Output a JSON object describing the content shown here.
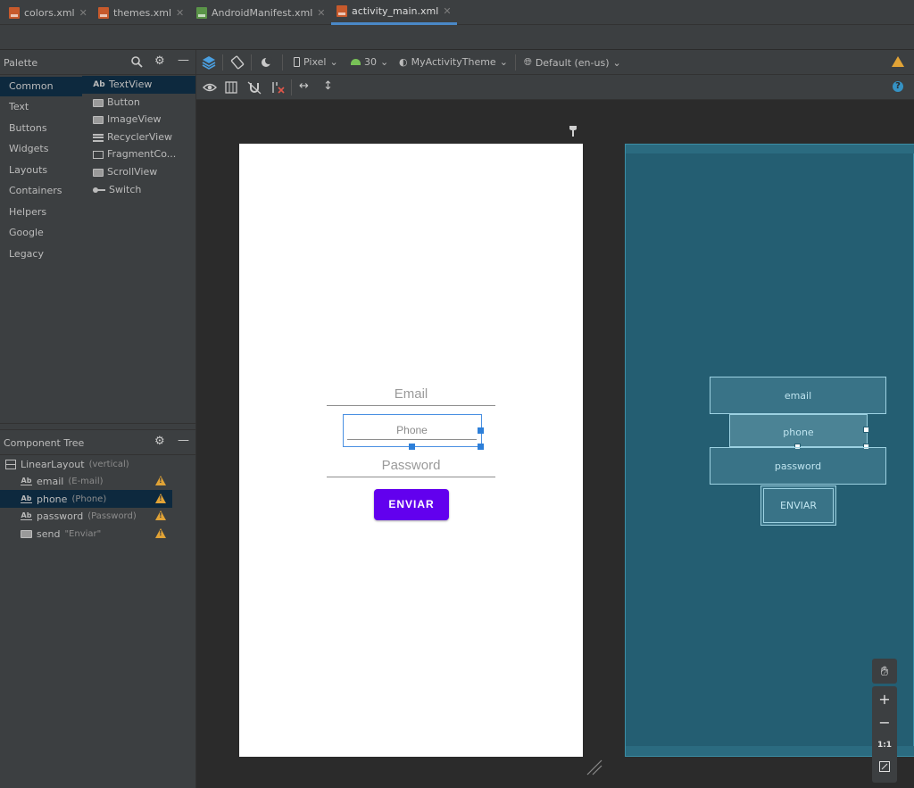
{
  "tabs": [
    {
      "label": "colors.xml",
      "icon": "xml-file-icon"
    },
    {
      "label": "themes.xml",
      "icon": "xml-file-icon"
    },
    {
      "label": "AndroidManifest.xml",
      "icon": "manifest-file-icon"
    },
    {
      "label": "activity_main.xml",
      "icon": "xml-file-icon",
      "active": true
    }
  ],
  "palette": {
    "title": "Palette",
    "categories": [
      "Common",
      "Text",
      "Buttons",
      "Widgets",
      "Layouts",
      "Containers",
      "Helpers",
      "Google",
      "Legacy"
    ],
    "selected_category": "Common",
    "items": [
      {
        "label": "TextView",
        "icon_glyph": "Ab"
      },
      {
        "label": "Button"
      },
      {
        "label": "ImageView"
      },
      {
        "label": "RecyclerView"
      },
      {
        "label": "FragmentCo..."
      },
      {
        "label": "ScrollView"
      },
      {
        "label": "Switch"
      }
    ]
  },
  "component_tree": {
    "title": "Component Tree",
    "root": {
      "label": "LinearLayout",
      "hint": "(vertical)"
    },
    "children": [
      {
        "icon_glyph": "Ab",
        "label": "email",
        "hint": "(E-mail)"
      },
      {
        "icon_glyph": "Ab",
        "label": "phone",
        "hint": "(Phone)",
        "selected": true
      },
      {
        "icon_glyph": "Ab",
        "label": "password",
        "hint": "(Password)"
      },
      {
        "label": "send",
        "hint": "\"Enviar\""
      }
    ]
  },
  "toolbar": {
    "device": "Pixel",
    "api": "30",
    "theme": "MyActivityTheme",
    "locale": "Default (en-us)"
  },
  "design": {
    "email_hint": "Email",
    "phone_hint": "Phone",
    "password_hint": "Password",
    "send_label": "ENVIAR"
  },
  "blueprint": {
    "email": "email",
    "phone": "phone",
    "password": "password",
    "send": "ENVIAR"
  },
  "zoom": {
    "reset_label": "1:1"
  },
  "colors": {
    "accent_button": "#6200ee",
    "blueprint_bg": "#245e72",
    "selection": "#2d7fd9",
    "warning": "#e1a336"
  }
}
